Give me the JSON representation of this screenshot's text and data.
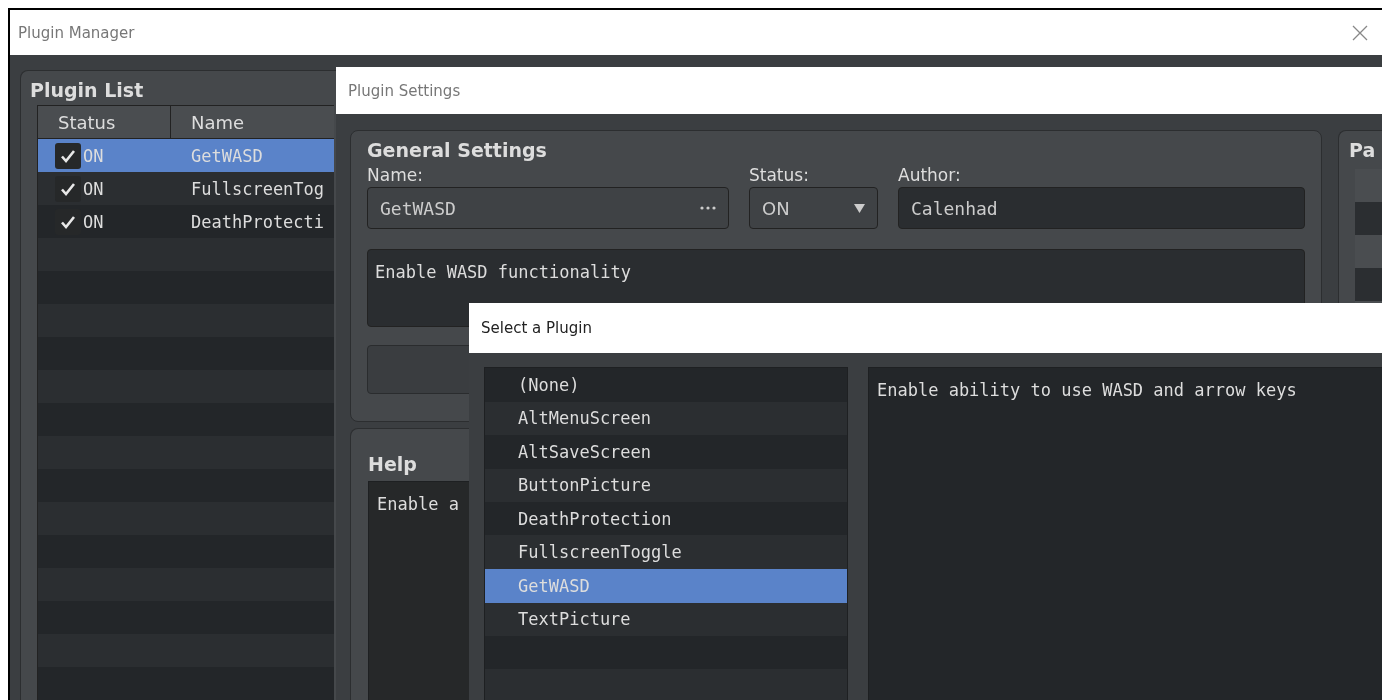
{
  "plugin_manager": {
    "title": "Plugin Manager",
    "plugin_list": {
      "title": "Plugin List",
      "columns": [
        "Status",
        "Name"
      ],
      "rows": [
        {
          "checked": true,
          "status": "ON",
          "name": "GetWASD",
          "selected": true
        },
        {
          "checked": true,
          "status": "ON",
          "name": "FullscreenTog",
          "selected": false
        },
        {
          "checked": true,
          "status": "ON",
          "name": "DeathProtecti",
          "selected": false
        }
      ]
    }
  },
  "plugin_settings": {
    "title": "Plugin Settings",
    "general": {
      "title": "General Settings",
      "name_label": "Name:",
      "name_value": "GetWASD",
      "status_label": "Status:",
      "status_value": "ON",
      "author_label": "Author:",
      "author_value": "Calenhad",
      "description": "Enable WASD functionality"
    },
    "parameters": {
      "title": "Pa"
    },
    "help": {
      "title": "Help",
      "text": "Enable a"
    }
  },
  "select_plugin": {
    "title": "Select a Plugin",
    "items": [
      {
        "label": "(None)",
        "selected": false
      },
      {
        "label": "AltMenuScreen",
        "selected": false
      },
      {
        "label": "AltSaveScreen",
        "selected": false
      },
      {
        "label": "ButtonPicture",
        "selected": false
      },
      {
        "label": "DeathProtection",
        "selected": false
      },
      {
        "label": "FullscreenToggle",
        "selected": false
      },
      {
        "label": "GetWASD",
        "selected": true
      },
      {
        "label": "TextPicture",
        "selected": false
      }
    ],
    "description": "Enable ability to use WASD and arrow keys"
  }
}
